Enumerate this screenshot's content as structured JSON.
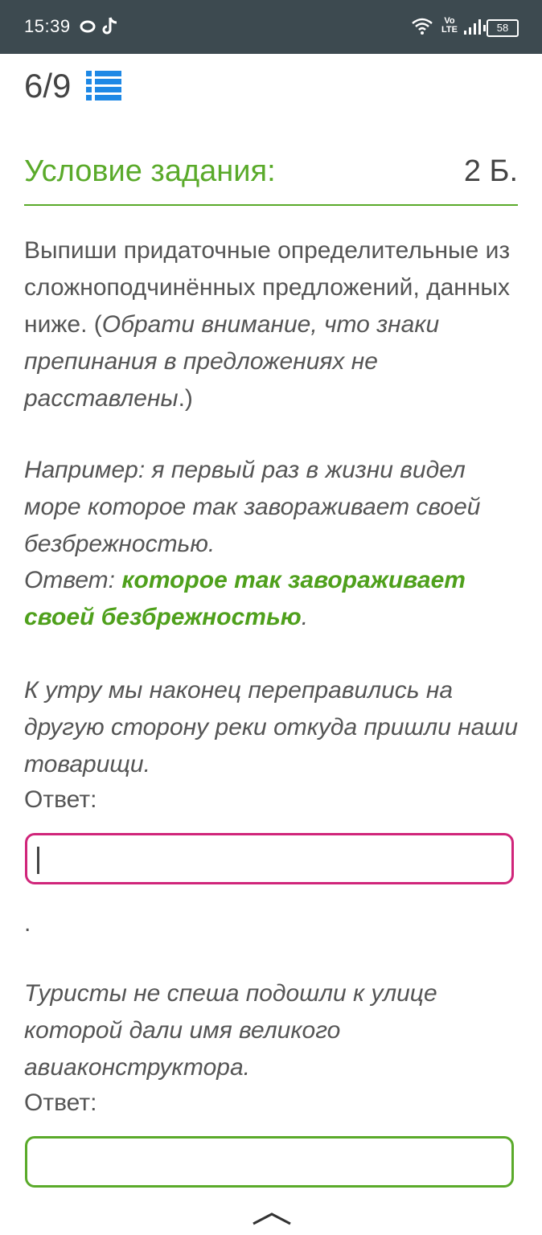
{
  "status_bar": {
    "time": "15:39",
    "network": "Vo LTE",
    "battery": "58"
  },
  "progress": {
    "current": "6",
    "total": "/9"
  },
  "header": {
    "title": "Условие задания:",
    "points": "2 Б."
  },
  "task": {
    "instruction_plain": "Выпиши придаточные определительные из сложноподчинённых предложений, данных ниже. (",
    "instruction_italic": "Обрати внимание, что знаки препинания в предложениях не расставлены",
    "instruction_close": ".)",
    "example_line": "Например: я первый раз в жизни видел море которое так завораживает своей безбрежностью.",
    "example_answer_label": "Ответ: ",
    "example_answer_value": "которое так завораживает своей безбрежностью",
    "example_answer_end": "."
  },
  "questions": [
    {
      "sentence": "К утру мы наконец переправились на другую сторону реки откуда пришли наши товарищи.",
      "answer_label": "Ответ:",
      "value": "",
      "after": "."
    },
    {
      "sentence": "Туристы не спеша подошли к улице которой дали имя великого авиаконструктора.",
      "answer_label": "Ответ:",
      "value": ""
    }
  ],
  "colors": {
    "accent_green": "#5aaa2a",
    "focus_border": "#d0257a",
    "status_bg": "#3d4a50",
    "icon_blue": "#1e88e5"
  }
}
